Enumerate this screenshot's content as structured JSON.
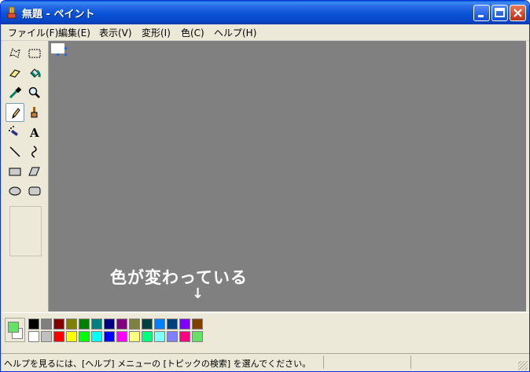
{
  "window": {
    "title": "無題 - ペイント",
    "icon": "paint-app-icon",
    "title_color": "#0b53d6"
  },
  "menu": [
    {
      "label": "ファイル(F)"
    },
    {
      "label": "編集(E)"
    },
    {
      "label": "表示(V)"
    },
    {
      "label": "変形(I)"
    },
    {
      "label": "色(C)"
    },
    {
      "label": "ヘルプ(H)"
    }
  ],
  "tools": [
    {
      "name": "free-form-select-icon"
    },
    {
      "name": "rect-select-icon"
    },
    {
      "name": "eraser-icon"
    },
    {
      "name": "fill-bucket-icon"
    },
    {
      "name": "color-picker-icon"
    },
    {
      "name": "magnifier-icon"
    },
    {
      "name": "pencil-icon",
      "active": true
    },
    {
      "name": "brush-icon"
    },
    {
      "name": "airbrush-icon"
    },
    {
      "name": "text-icon"
    },
    {
      "name": "line-icon"
    },
    {
      "name": "curve-icon"
    },
    {
      "name": "rectangle-icon"
    },
    {
      "name": "polygon-icon"
    },
    {
      "name": "ellipse-icon"
    },
    {
      "name": "rounded-rect-icon"
    }
  ],
  "canvas": {
    "background": "#808080",
    "annotation": "色が変わっている",
    "arrow": "↓"
  },
  "palette": {
    "foreground": "#66e066",
    "background": "#ffffff",
    "row1": [
      "#000000",
      "#808080",
      "#800000",
      "#808000",
      "#008000",
      "#008080",
      "#000080",
      "#800080",
      "#808040",
      "#004040",
      "#0080ff",
      "#004080",
      "#8000ff",
      "#804000"
    ],
    "row2": [
      "#ffffff",
      "#c0c0c0",
      "#ff0000",
      "#ffff00",
      "#00ff00",
      "#00ffff",
      "#0000ff",
      "#ff00ff",
      "#ffff80",
      "#00ff80",
      "#80ffff",
      "#8080ff",
      "#ff0080",
      "#66e066"
    ]
  },
  "status": {
    "text": "ヘルプを見るには、[ヘルプ] メニューの [トピックの検索] を選んでください。"
  }
}
